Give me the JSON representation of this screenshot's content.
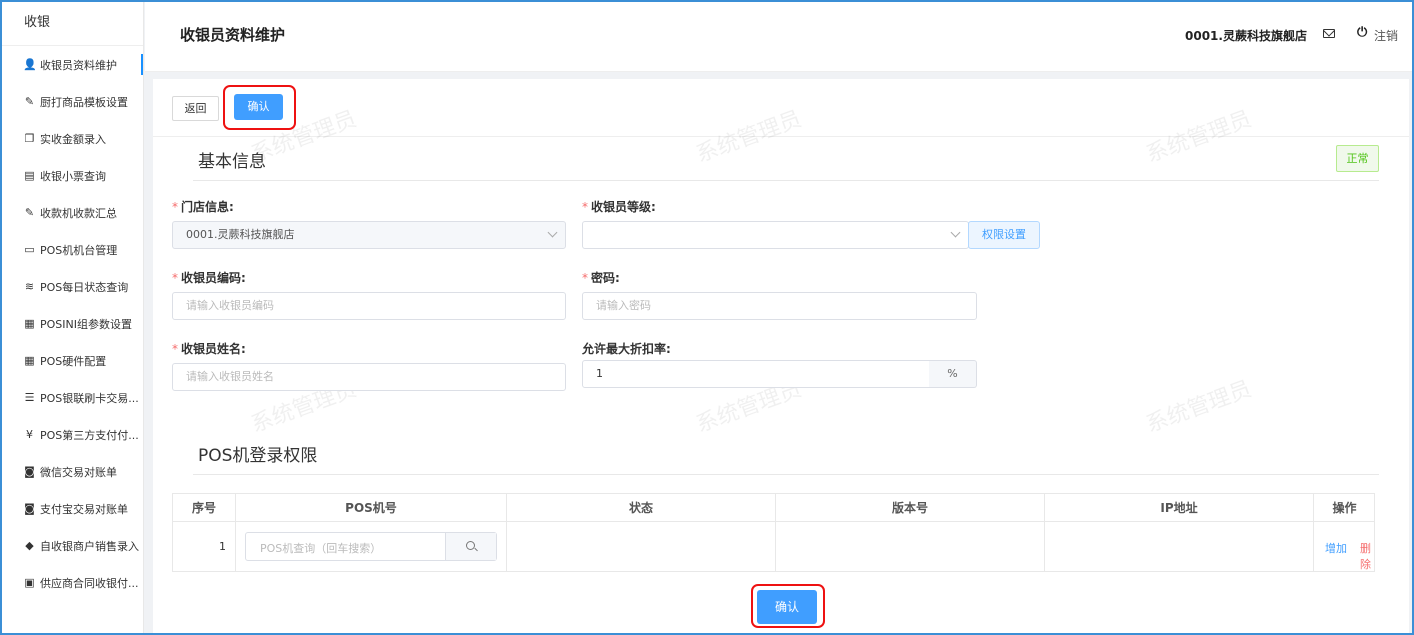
{
  "sidebar": {
    "title": "收银",
    "items": [
      {
        "label": "收银员资料维护",
        "icon": "user-icon",
        "glyph": "👤"
      },
      {
        "label": "厨打商品模板设置",
        "icon": "edit-icon",
        "glyph": "✎"
      },
      {
        "label": "实收金额录入",
        "icon": "copy-icon",
        "glyph": "❐"
      },
      {
        "label": "收银小票查询",
        "icon": "receipt-icon",
        "glyph": "▤"
      },
      {
        "label": "收款机收款汇总",
        "icon": "doc-edit-icon",
        "glyph": "✎"
      },
      {
        "label": "POS机机台管理",
        "icon": "printer-icon",
        "glyph": "▭"
      },
      {
        "label": "POS每日状态查询",
        "icon": "layers-icon",
        "glyph": "≋"
      },
      {
        "label": "POSINI组参数设置",
        "icon": "grid-icon",
        "glyph": "▦"
      },
      {
        "label": "POS硬件配置",
        "icon": "grid-icon",
        "glyph": "▦"
      },
      {
        "label": "POS银联刷卡交易...",
        "icon": "list-icon",
        "glyph": "☰"
      },
      {
        "label": "POS第三方支付付...",
        "icon": "yen-circle-icon",
        "glyph": "¥"
      },
      {
        "label": "微信交易对账单",
        "icon": "wechat-icon",
        "glyph": "◙"
      },
      {
        "label": "支付宝交易对账单",
        "icon": "alipay-icon",
        "glyph": "◙"
      },
      {
        "label": "自收银商户销售录入",
        "icon": "tag-icon",
        "glyph": "◆"
      },
      {
        "label": "供应商合同收银付...",
        "icon": "wallet-icon",
        "glyph": "▣"
      }
    ]
  },
  "header": {
    "title": "收银员资料维护",
    "store": "0001.灵蕨科技旗舰店",
    "logout": "注销"
  },
  "toolbar": {
    "back_label": "返回",
    "confirm_label": "确认"
  },
  "basic": {
    "section_title": "基本信息",
    "status": "正常",
    "store_label": "门店信息:",
    "store_value": "0001.灵蕨科技旗舰店",
    "level_label": "收银员等级:",
    "level_value": "",
    "perm_button": "权限设置",
    "code_label": "收银员编码:",
    "code_placeholder": "请输入收银员编码",
    "password_label": "密码:",
    "password_placeholder": "请输入密码",
    "name_label": "收银员姓名:",
    "name_placeholder": "请输入收银员姓名",
    "discount_label": "允许最大折扣率:",
    "discount_value": "1",
    "discount_unit": "%"
  },
  "pos": {
    "section_title": "POS机登录权限",
    "columns": [
      "序号",
      "POS机号",
      "状态",
      "版本号",
      "IP地址",
      "操作"
    ],
    "rows": [
      {
        "no": "1",
        "search_placeholder": "POS机查询（回车搜索）",
        "status": "",
        "version": "",
        "ip": "",
        "add": "增加",
        "delete": "删除"
      }
    ]
  },
  "footer": {
    "confirm_label": "确认"
  },
  "watermark": "系统管理员",
  "colors": {
    "primary": "#409eff",
    "danger": "#f56c6c",
    "success": "#52c41a",
    "highlight": "#e11111"
  }
}
